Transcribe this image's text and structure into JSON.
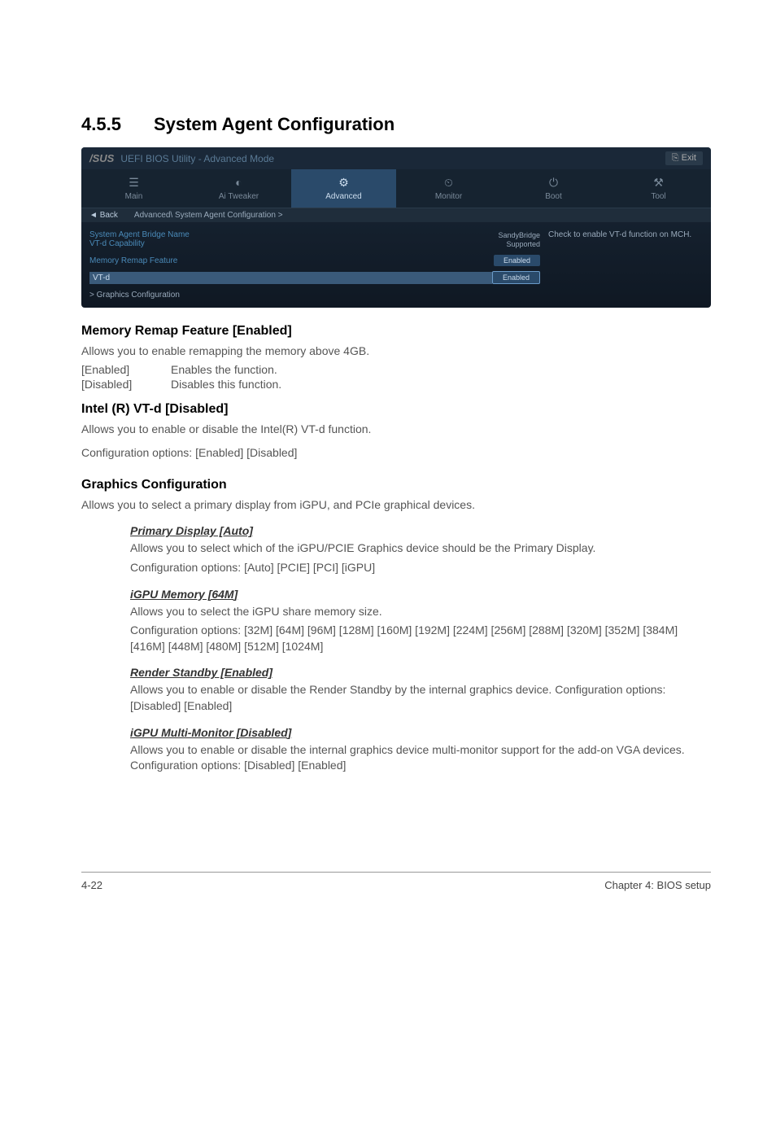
{
  "section": {
    "number": "4.5.5",
    "title": "System Agent Configuration"
  },
  "bios": {
    "logo": "/SUS",
    "headerTitle": "UEFI BIOS Utility - Advanced Mode",
    "exit": "Exit",
    "tabs": [
      {
        "icon": "☰",
        "label": "Main"
      },
      {
        "icon": "◐",
        "label": "Ai Tweaker"
      },
      {
        "icon": "⚙",
        "label": "Advanced"
      },
      {
        "icon": "⏲",
        "label": "Monitor"
      },
      {
        "icon": "⏻",
        "label": "Boot"
      },
      {
        "icon": "⚒",
        "label": "Tool"
      }
    ],
    "backLabel": "Back",
    "breadcrumb": "Advanced\\ System Agent Configuration >",
    "rows": [
      {
        "label": "System Agent Bridge Name",
        "value": "SandyBridge",
        "type": "text"
      },
      {
        "label": "VT-d Capability",
        "value": "Supported",
        "type": "text"
      },
      {
        "label": "Memory Remap Feature",
        "value": "Enabled",
        "type": "box"
      },
      {
        "label": "VT-d",
        "value": "Enabled",
        "type": "box-hl"
      }
    ],
    "expandRow": "> Graphics Configuration",
    "helpText": "Check to enable VT-d function on MCH."
  },
  "memRemap": {
    "title": "Memory Remap Feature [Enabled]",
    "desc": "Allows you to enable remapping the memory above 4GB.",
    "opts": [
      {
        "k": "[Enabled]",
        "v": "Enables the function."
      },
      {
        "k": "[Disabled]",
        "v": "Disables this function."
      }
    ]
  },
  "vtd": {
    "title": "Intel (R) VT-d [Disabled]",
    "desc": "Allows you to enable or disable the Intel(R) VT-d function.",
    "config": "Configuration options:  [Enabled] [Disabled]"
  },
  "graphics": {
    "title": "Graphics Configuration",
    "desc": "Allows you to select a primary display from iGPU, and PCIe graphical devices.",
    "items": [
      {
        "title": "Primary Display [Auto]",
        "desc": "Allows you to select which of the iGPU/PCIE Graphics device should be the Primary Display.",
        "config": "Configuration options: [Auto] [PCIE] [PCI] [iGPU]"
      },
      {
        "title": "iGPU Memory [64M]",
        "desc": "Allows you to select the iGPU share memory size.",
        "config": "Configuration options: [32M] [64M] [96M] [128M] [160M] [192M] [224M] [256M] [288M] [320M] [352M] [384M] [416M] [448M] [480M] [512M] [1024M]"
      },
      {
        "title": "Render Standby [Enabled]",
        "desc": "Allows you to enable or disable the Render Standby by the internal graphics device. Configuration options: [Disabled] [Enabled]",
        "config": ""
      },
      {
        "title": "iGPU Multi-Monitor [Disabled]",
        "desc": "Allows you to enable or disable the internal graphics device multi-monitor support for the add-on VGA devices. Configuration options: [Disabled] [Enabled]",
        "config": ""
      }
    ]
  },
  "footer": {
    "left": "4-22",
    "right": "Chapter 4: BIOS setup"
  }
}
